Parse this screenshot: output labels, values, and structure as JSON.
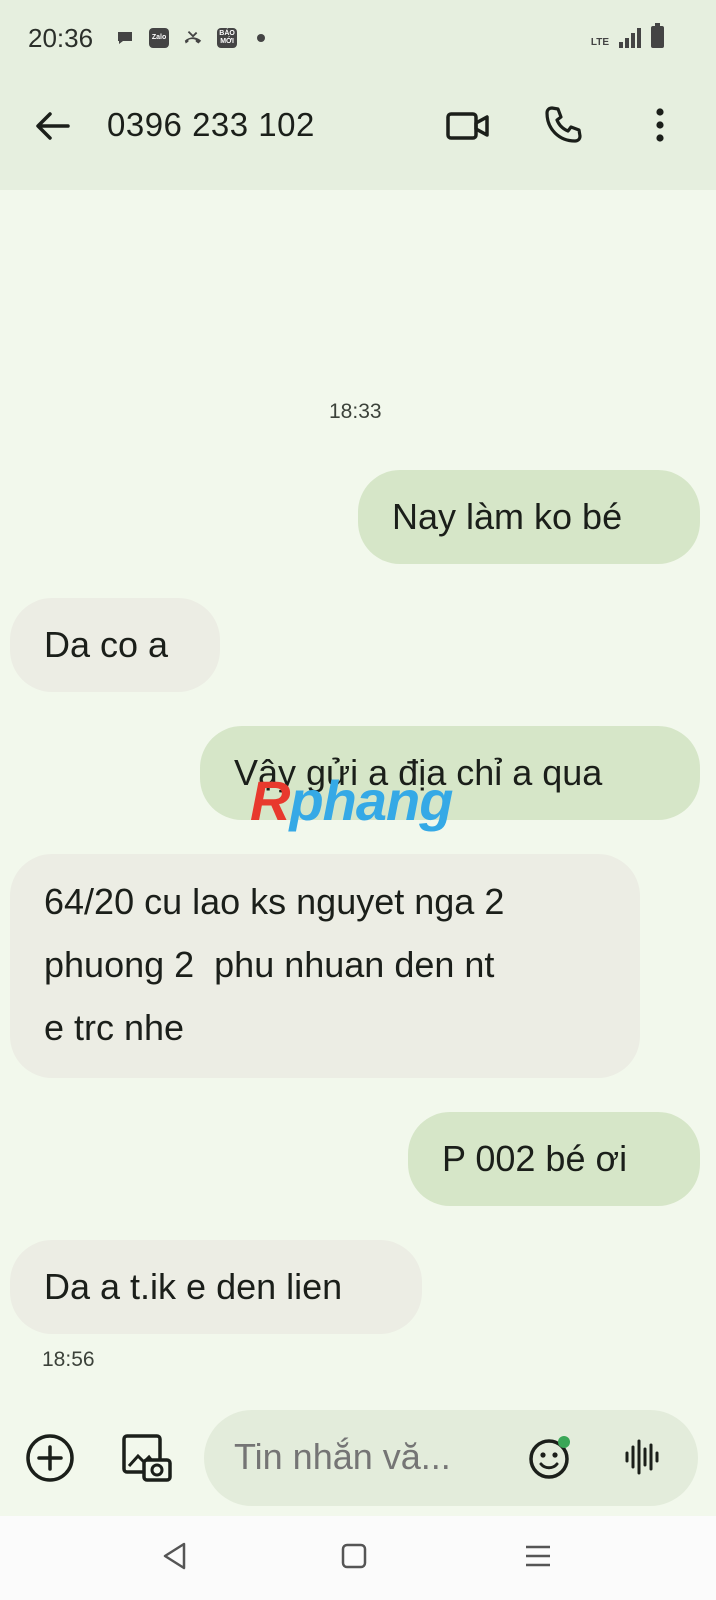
{
  "status_bar": {
    "time": "20:36",
    "network": "LTE",
    "icons": [
      "chat-icon",
      "zalo-icon",
      "missed-call-icon",
      "baomoi-icon",
      "notification-dot",
      "signal-icon",
      "battery-icon"
    ],
    "zalo_text": "Zalo",
    "baomoi_text": "BÁO MỚI"
  },
  "header": {
    "contact": "0396 233 102",
    "actions": [
      "back-arrow-icon",
      "video-call-icon",
      "phone-icon",
      "more-vert-icon"
    ]
  },
  "conversation": {
    "messages": [
      {
        "type": "timestamp",
        "text": "18:33"
      },
      {
        "direction": "outgoing",
        "text": "Nay làm ko bé"
      },
      {
        "direction": "incoming",
        "text": "Da co a"
      },
      {
        "direction": "outgoing",
        "text": "Vậy gửi a địa chỉ a qua"
      },
      {
        "direction": "incoming",
        "lines": [
          "64/20 cu lao ks nguyet nga 2",
          "phuong 2  phu nhuan den nt",
          "e trc nhe"
        ]
      },
      {
        "direction": "outgoing",
        "text": "P 002 bé ơi"
      },
      {
        "direction": "incoming",
        "text": "Da a t.ik e den lien"
      },
      {
        "type": "timestamp",
        "text": "18:56"
      }
    ]
  },
  "watermark": {
    "first": "R",
    "rest": "phang"
  },
  "composer": {
    "placeholder": "Tin nhắn vă...",
    "icons": [
      "add-circle-icon",
      "gallery-camera-icon",
      "emoji-icon",
      "voice-wave-icon"
    ]
  },
  "colors": {
    "background": "#f2f8ec",
    "header_bg": "#e6efdf",
    "outgoing_bubble": "#d6e6c8",
    "incoming_bubble": "#ecede4",
    "composer_bg": "#e3ecdb",
    "emoji_badge": "#3aa757"
  }
}
